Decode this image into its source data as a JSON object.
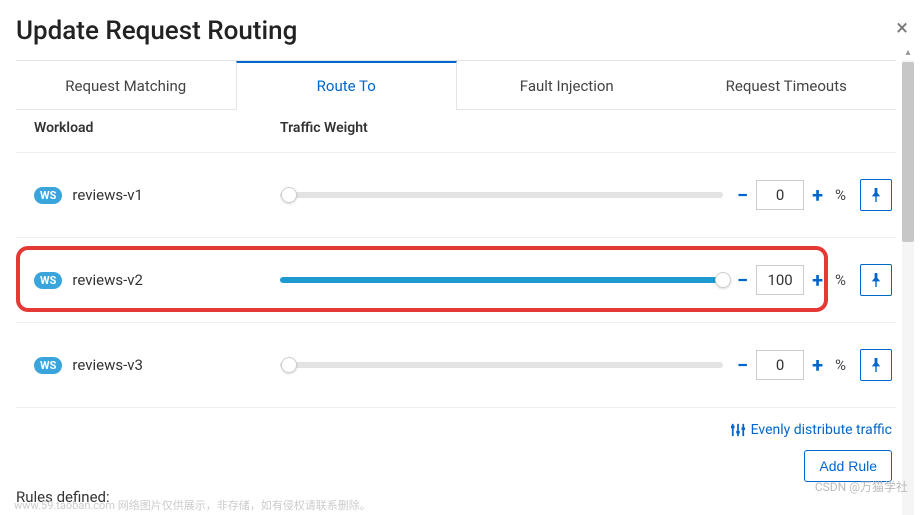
{
  "modal": {
    "title": "Update Request Routing",
    "close": "×"
  },
  "tabs": [
    {
      "label": "Request Matching",
      "active": false
    },
    {
      "label": "Route To",
      "active": true
    },
    {
      "label": "Fault Injection",
      "active": false
    },
    {
      "label": "Request Timeouts",
      "active": false
    }
  ],
  "columns": {
    "workload": "Workload",
    "weight": "Traffic Weight"
  },
  "badge": "WS",
  "percent_sign": "%",
  "rows": [
    {
      "name": "reviews-v1",
      "value": 0,
      "slider_pct": 2,
      "highlighted": false
    },
    {
      "name": "reviews-v2",
      "value": 100,
      "slider_pct": 100,
      "highlighted": true
    },
    {
      "name": "reviews-v3",
      "value": 0,
      "slider_pct": 2,
      "highlighted": false
    }
  ],
  "footer": {
    "evenly": "Evenly distribute traffic",
    "add_rule": "Add Rule",
    "rules_defined": "Rules defined:"
  },
  "watermarks": {
    "csdn": "CSDN @万猫学社",
    "taobao": "www.59.taoban.com 网络图片仅供展示，非存储，如有侵权请联系删除。"
  }
}
